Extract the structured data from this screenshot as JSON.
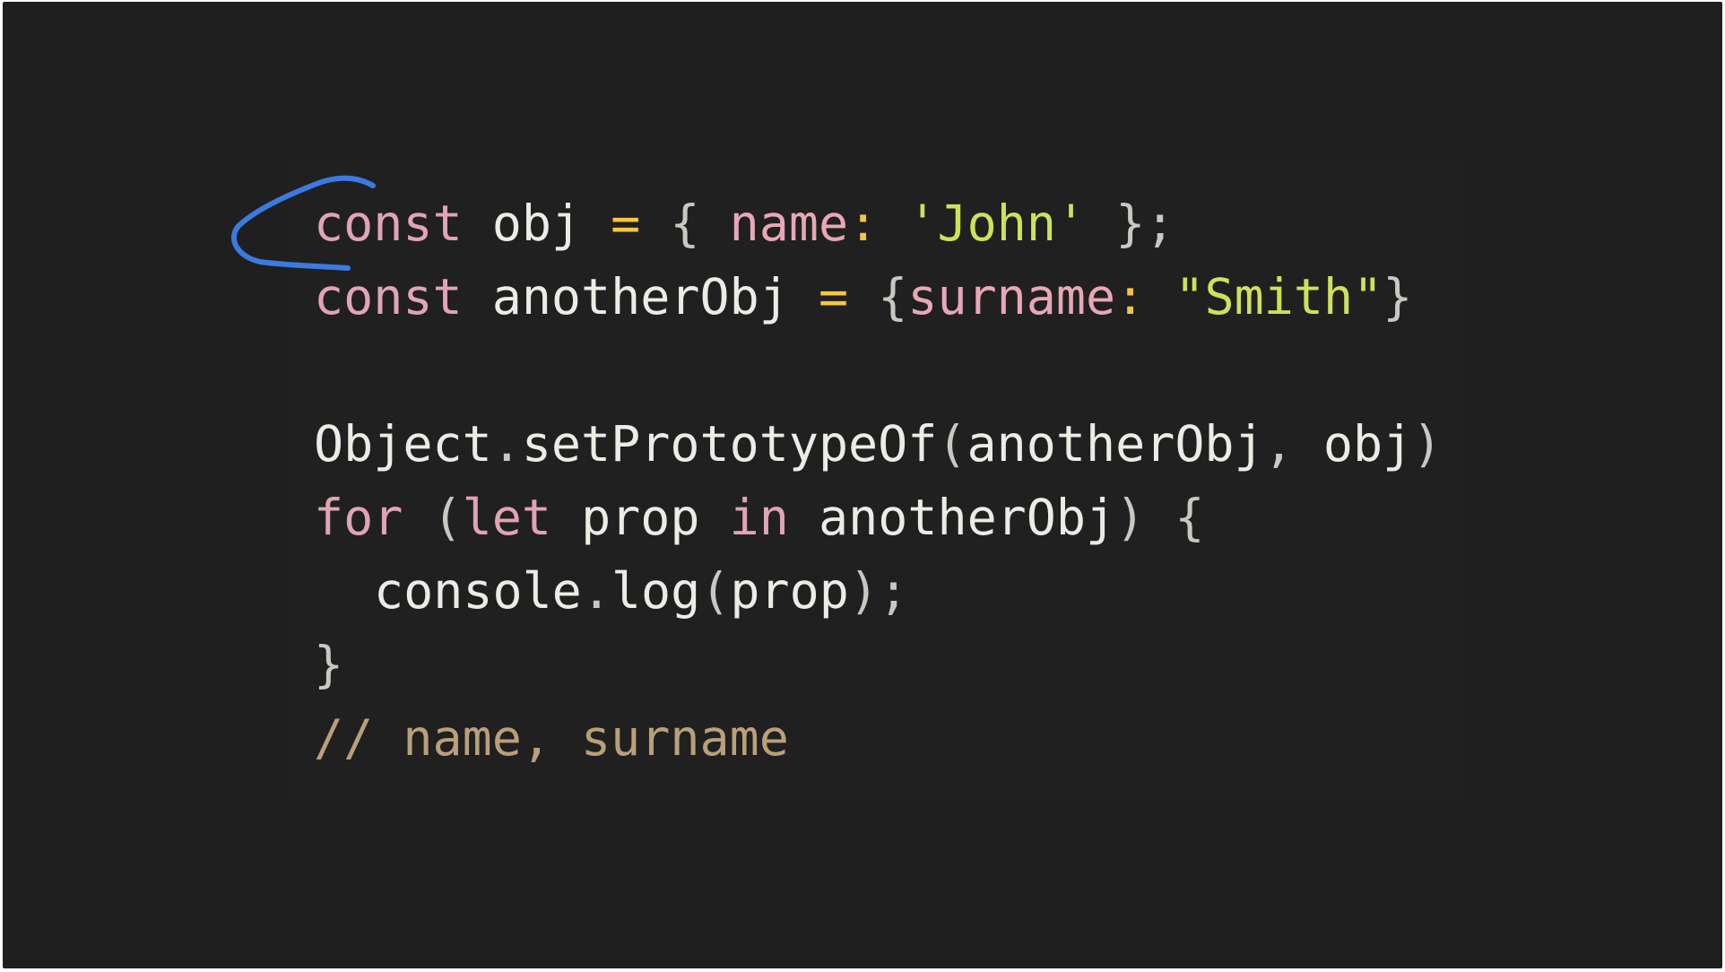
{
  "colors": {
    "background": "#1f1f1f",
    "keyword": "#e0a4b4",
    "property": "#e8a7b8",
    "operator": "#f5c542",
    "string": "#cfe15a",
    "identifier": "#ecebe6",
    "punctuation": "#c9c7c2",
    "comment": "#b9a07a",
    "annotation": "#3b7ae0"
  },
  "annotation": {
    "shape": "hand-drawn blue arc marking line 1"
  },
  "code": {
    "line1": {
      "kw": "const",
      "name": "obj",
      "eq": "=",
      "open": "{",
      "key": "name",
      "colon": ":",
      "value": "'John'",
      "close": "};"
    },
    "line2": {
      "kw": "const",
      "name": "anotherObj",
      "eq": "=",
      "open": "{",
      "key": "surname",
      "colon": ":",
      "value": "\"Smith\"",
      "close": "}"
    },
    "line3": {
      "obj": "Object",
      "dot": ".",
      "method": "setPrototypeOf",
      "open": "(",
      "arg1": "anotherObj",
      "comma": ",",
      "arg2": "obj",
      "close": ")"
    },
    "line4": {
      "kw_for": "for",
      "open": "(",
      "kw_let": "let",
      "var": "prop",
      "kw_in": "in",
      "target": "anotherObj",
      "close": ")",
      "brace": "{"
    },
    "line5": {
      "obj": "console",
      "dot": ".",
      "method": "log",
      "open": "(",
      "arg": "prop",
      "close": ");"
    },
    "line6": {
      "brace": "}"
    },
    "line7": {
      "slashes": "//",
      "text": "name, surname"
    }
  }
}
